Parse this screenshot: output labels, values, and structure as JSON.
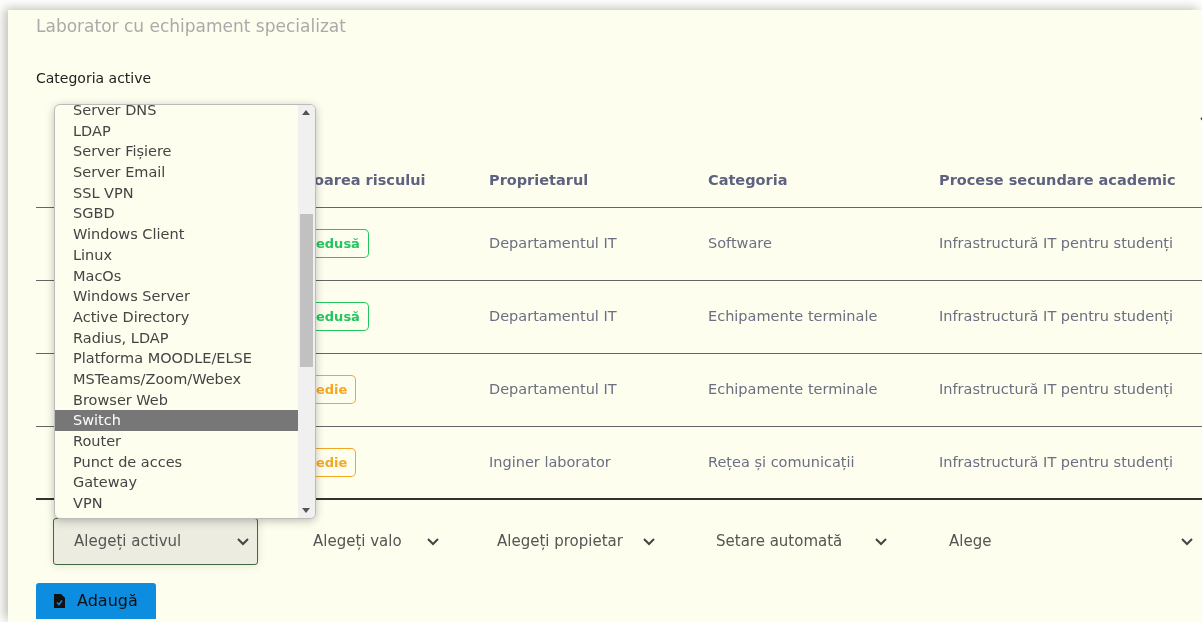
{
  "page": {
    "subtitle": "Laborator cu echipament specializat"
  },
  "category_field": {
    "label": "Categoria active"
  },
  "category_dropdown": {
    "options": [
      {
        "label": "Server DNS",
        "selected": false
      },
      {
        "label": "LDAP",
        "selected": false
      },
      {
        "label": "Server Fișiere",
        "selected": false
      },
      {
        "label": "Server Email",
        "selected": false
      },
      {
        "label": "SSL VPN",
        "selected": false
      },
      {
        "label": "SGBD",
        "selected": false
      },
      {
        "label": "Windows Client",
        "selected": false
      },
      {
        "label": "Linux",
        "selected": false
      },
      {
        "label": "MacOs",
        "selected": false
      },
      {
        "label": "Windows Server",
        "selected": false
      },
      {
        "label": "Active Directory",
        "selected": false
      },
      {
        "label": "Radius, LDAP",
        "selected": false
      },
      {
        "label": "Platforma MOODLE/ELSE",
        "selected": false
      },
      {
        "label": "MSTeams/Zoom/Webex",
        "selected": false
      },
      {
        "label": "Browser Web",
        "selected": false
      },
      {
        "label": "Switch",
        "selected": true
      },
      {
        "label": "Router",
        "selected": false
      },
      {
        "label": "Punct de acces",
        "selected": false
      },
      {
        "label": "Gateway",
        "selected": false
      },
      {
        "label": "VPN",
        "selected": false
      }
    ]
  },
  "table": {
    "columns": [
      "oarea riscului",
      "Proprietarul",
      "Categoria",
      "Procese secundare academic"
    ],
    "rows": [
      {
        "risk": "edusă",
        "color": "#22c55e",
        "owner": "Departamentul IT",
        "category": "Software",
        "process": "Infrastructură IT pentru studenți"
      },
      {
        "risk": "edusă",
        "color": "#22c55e",
        "owner": "Departamentul IT",
        "category": "Echipamente terminale",
        "process": "Infrastructură IT pentru studenți"
      },
      {
        "risk": "edie",
        "color": "#f5a623",
        "owner": "Departamentul IT",
        "category": "Echipamente terminale",
        "process": "Infrastructură IT pentru studenți"
      },
      {
        "risk": "edie",
        "color": "#f5a623",
        "owner": "Inginer laborator",
        "category": "Rețea și comunicații",
        "process": "Infrastructură IT pentru studenți"
      }
    ]
  },
  "form_row": {
    "selects": [
      {
        "value": "Alegeți activul",
        "focused": true
      },
      {
        "value": "Alegeți valo",
        "focused": false
      },
      {
        "value": "Alegeți propietar",
        "focused": false
      },
      {
        "value": "Setare automată",
        "focused": false
      },
      {
        "value": "Alege",
        "focused": false
      }
    ]
  },
  "add_button": {
    "label": "Adaugă"
  }
}
